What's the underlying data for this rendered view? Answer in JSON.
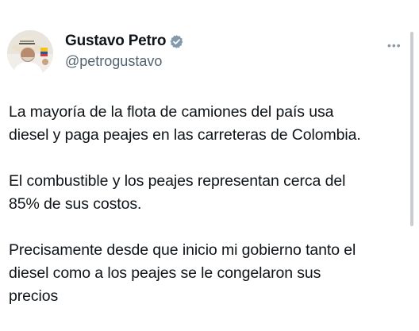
{
  "author": {
    "display_name": "Gustavo Petro",
    "handle": "@petrogustavo",
    "verified": true,
    "avatar_icon": "profile-photo-hat",
    "verified_badge_color": "#829aab"
  },
  "more_menu_icon": "ellipsis-icon",
  "paragraphs": [
    "La mayoría de la flota de camiones del país usa\ndiesel y paga peajes en las carreteras de Colombia.",
    "El combustible y los peajes representan cerca del\n85% de sus costos.",
    "Precisamente desde que inicio mi gobierno tanto el\ndiesel como a los peajes se le congelaron sus\nprecios"
  ]
}
